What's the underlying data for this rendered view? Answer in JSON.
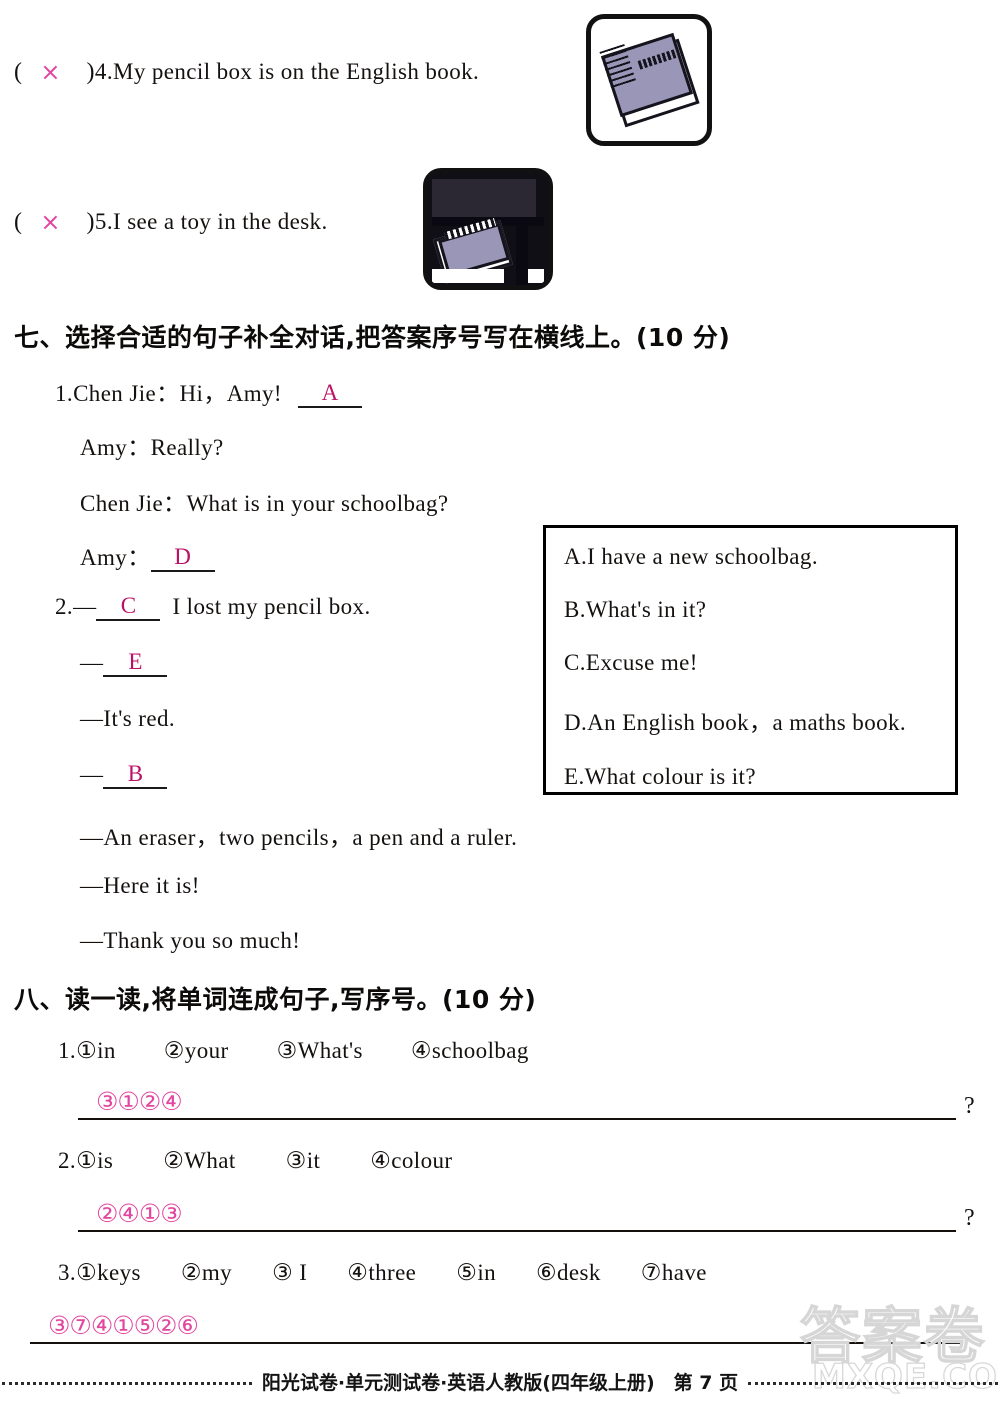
{
  "true_false": {
    "items": [
      {
        "mark": "×",
        "number": "4.",
        "text": "My pencil box is on the English book.",
        "picture": "notebook-icon"
      },
      {
        "mark": "×",
        "number": "5.",
        "text": "I see a toy in the desk.",
        "picture": "notebook-under-desk-icon"
      }
    ],
    "paren_open": "(",
    "paren_close": ")"
  },
  "section_seven": {
    "heading": "七、选择合适的句子补全对话,把答案序号写在横线上。(10 分)",
    "dialogue1": {
      "number": "1.",
      "lines": [
        {
          "speaker": "Chen Jie：",
          "text": "Hi，Amy!",
          "answer": "A"
        },
        {
          "speaker": "Amy：",
          "text": "Really?",
          "answer": ""
        },
        {
          "speaker": "Chen Jie：",
          "text": "What is in your schoolbag?",
          "answer": ""
        },
        {
          "speaker": "Amy：",
          "text": "",
          "answer": "D"
        }
      ]
    },
    "dialogue2": {
      "number": "2.",
      "lines": [
        {
          "dash": "—",
          "answer": "C",
          "text": "I lost my pencil box."
        },
        {
          "dash": "—",
          "answer": "E",
          "text": ""
        },
        {
          "dash": "—",
          "answer": "",
          "text": "It's red."
        },
        {
          "dash": "—",
          "answer": "B",
          "text": ""
        },
        {
          "dash": "—",
          "answer": "",
          "text": "An eraser，two pencils，a pen and a ruler."
        },
        {
          "dash": "—",
          "answer": "",
          "text": "Here it is!"
        },
        {
          "dash": "—",
          "answer": "",
          "text": "Thank you so much!"
        }
      ]
    },
    "choices": [
      "A.I have a new schoolbag.",
      "B.What's in it?",
      "C.Excuse me!",
      "D.An English book，a maths book.",
      "E.What colour is it?"
    ]
  },
  "section_eight": {
    "heading": "八、读一读,将单词连成句子,写序号。(10 分)",
    "items": [
      {
        "number": "1.",
        "words": [
          "①in",
          "②your",
          "③What's",
          "④schoolbag"
        ],
        "answer": "③①②④",
        "end_mark": "?"
      },
      {
        "number": "2.",
        "words": [
          "①is",
          "②What",
          "③it",
          "④colour"
        ],
        "answer": "②④①③",
        "end_mark": "?"
      },
      {
        "number": "3.",
        "words": [
          "①keys",
          "②my",
          "③ I",
          "④three",
          "⑤in",
          "⑥desk",
          "⑦have"
        ],
        "answer": "③⑦④①⑤②⑥",
        "end_mark": ""
      }
    ]
  },
  "footer": {
    "text": "阳光试卷·单元测试卷·英语人教版(四年级上册)　第 7 页"
  },
  "watermark": {
    "chinese": "答案卷",
    "site": "MXQE.COM"
  },
  "colors": {
    "answer_ink": "#bb1166",
    "mark_ink": "#e246a0",
    "text": "#14110f"
  }
}
